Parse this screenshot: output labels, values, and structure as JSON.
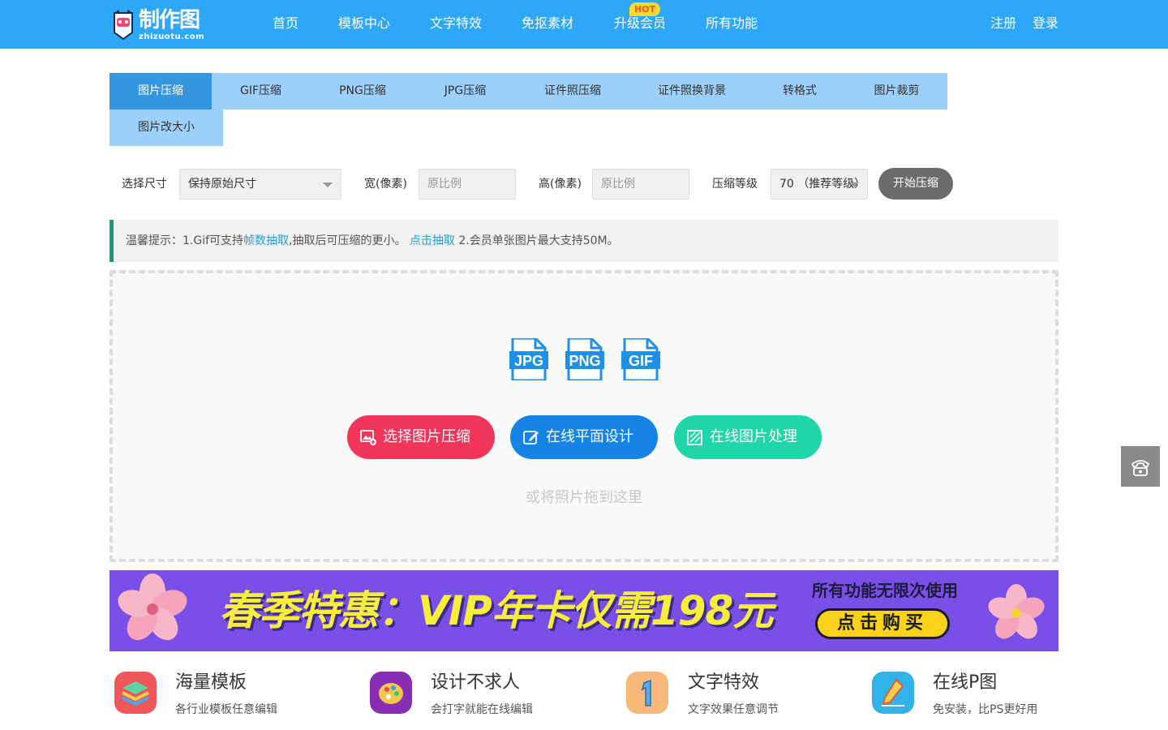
{
  "header": {
    "logo_text": "制作图",
    "logo_sub": "zhizuotu.com",
    "nav": [
      "首页",
      "模板中心",
      "文字特效",
      "免抠素材",
      "升级会员",
      "所有功能"
    ],
    "hot_badge": "HOT",
    "register": "注册",
    "login": "登录"
  },
  "tabs": {
    "items": [
      "图片压缩",
      "GIF压缩",
      "PNG压缩",
      "JPG压缩",
      "证件照压缩",
      "证件照换背景",
      "转格式",
      "图片裁剪"
    ],
    "second_row": "图片改大小",
    "active": "图片压缩"
  },
  "controls": {
    "size_label": "选择尺寸",
    "size_value": "保持原始尺寸",
    "width_label": "宽(像素)",
    "width_placeholder": "原比例",
    "height_label": "高(像素)",
    "height_placeholder": "原比例",
    "level_label": "压缩等级",
    "level_value": "70 （推荐等级）",
    "start_button": "开始压缩"
  },
  "notice": {
    "prefix": "温馨提示：1.Gif可支持",
    "link1": "帧数抽取",
    "middle": ",抽取后可压缩的更小。",
    "link2": "点击抽取",
    "suffix": "2.会员单张图片最大支持50M。"
  },
  "upload": {
    "file_types": [
      "JPG",
      "PNG",
      "GIF"
    ],
    "btn_compress": "选择图片压缩",
    "btn_design": "在线平面设计",
    "btn_process": "在线图片处理",
    "drop_hint": "或将照片拖到这里"
  },
  "banner": {
    "main": "春季特惠：VIP年卡仅需198元",
    "right_title": "所有功能无限次使用",
    "buy": "点击购买"
  },
  "features": [
    {
      "title": "海量模板",
      "desc": "各行业模板任意编辑"
    },
    {
      "title": "设计不求人",
      "desc": "会打字就能在线编辑"
    },
    {
      "title": "文字特效",
      "desc": "文字效果任意调节"
    },
    {
      "title": "在线P图",
      "desc": "免安装，比PS更好用"
    }
  ],
  "colors": {
    "header_bg": "#2ea7f9",
    "tab_bg": "#9ccffa",
    "tab_active": "#3596e0",
    "btn_compress": "#f2355a",
    "btn_design": "#1584e6",
    "btn_process": "#1fd6a8",
    "banner_bg": "#7a4fe8"
  }
}
